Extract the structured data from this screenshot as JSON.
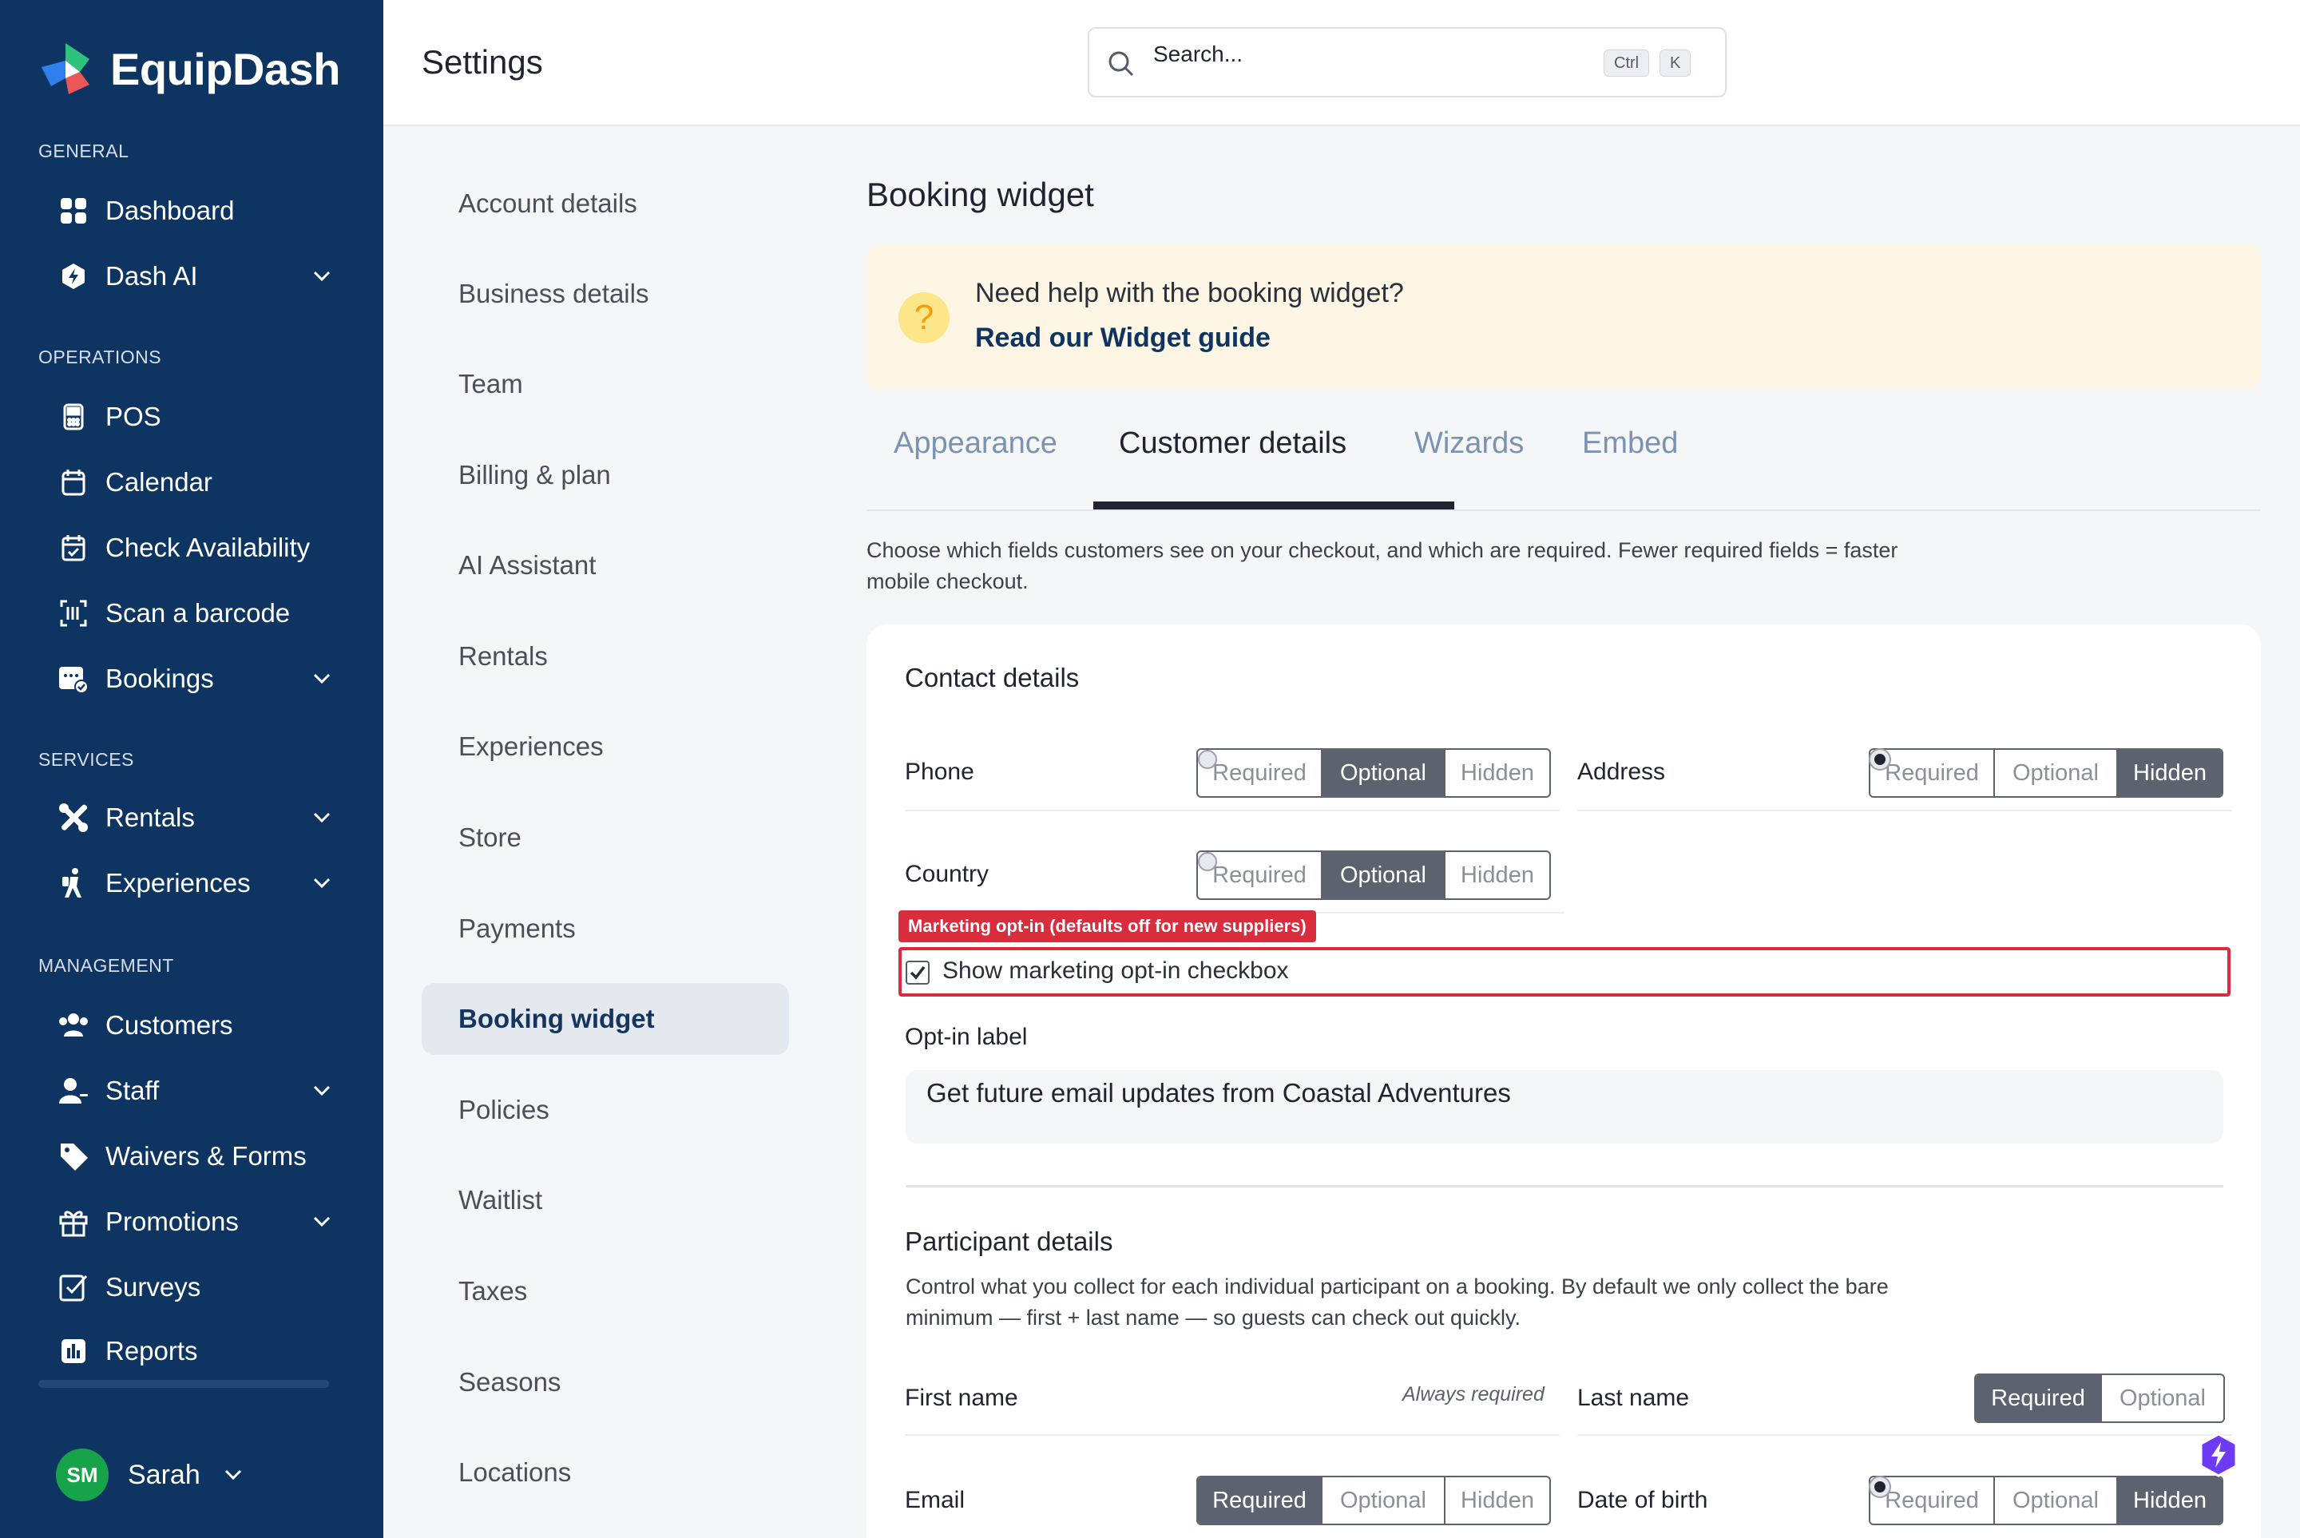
{
  "brand": {
    "name": "EquipDash"
  },
  "sidebar": {
    "sections": {
      "general": "GENERAL",
      "operations": "OPERATIONS",
      "services": "SERVICES",
      "management": "MANAGEMENT"
    },
    "items": [
      {
        "label": "Dashboard",
        "icon": "grid-icon"
      },
      {
        "label": "Dash AI",
        "icon": "sparkle-hex-icon"
      },
      {
        "label": "POS",
        "icon": "pos-terminal-icon"
      },
      {
        "label": "Calendar",
        "icon": "calendar-icon"
      },
      {
        "label": "Check Availability",
        "icon": "calendar-check-icon"
      },
      {
        "label": "Scan a barcode",
        "icon": "barcode-scan-icon"
      },
      {
        "label": "Bookings",
        "icon": "bookings-calendar-icon"
      },
      {
        "label": "Rentals",
        "icon": "tools-icon"
      },
      {
        "label": "Experiences",
        "icon": "hiking-person-icon"
      },
      {
        "label": "Customers",
        "icon": "users-icon"
      },
      {
        "label": "Staff",
        "icon": "staff-icon"
      },
      {
        "label": "Waivers & Forms",
        "icon": "tag-icon"
      },
      {
        "label": "Promotions",
        "icon": "gift-icon"
      },
      {
        "label": "Surveys",
        "icon": "checklist-icon"
      },
      {
        "label": "Reports",
        "icon": "bar-chart-icon"
      }
    ],
    "user": {
      "initials": "SM",
      "name": "Sarah"
    }
  },
  "topbar": {
    "title": "Settings",
    "search": {
      "placeholder": "Search...",
      "shortcut_1": "Ctrl",
      "shortcut_2": "K"
    }
  },
  "settings_nav": [
    "Account details",
    "Business details",
    "Team",
    "Billing & plan",
    "AI Assistant",
    "Rentals",
    "Experiences",
    "Store",
    "Payments",
    "Booking widget",
    "Policies",
    "Waitlist",
    "Taxes",
    "Seasons",
    "Locations"
  ],
  "main": {
    "heading": "Booking widget",
    "help": {
      "question": "Need help with the booking widget?",
      "link": "Read our Widget guide"
    },
    "tabs": [
      "Appearance",
      "Customer details",
      "Wizards",
      "Embed"
    ],
    "intro": "Choose which fields customers see on your checkout, and which are required. Fewer required fields = faster mobile checkout.",
    "contact": {
      "title": "Contact details",
      "fields": [
        {
          "label": "Phone",
          "selected": "Optional"
        },
        {
          "label": "Address",
          "selected": "Hidden"
        },
        {
          "label": "Country",
          "selected": "Optional"
        }
      ],
      "options": {
        "required": "Required",
        "optional": "Optional",
        "hidden": "Hidden"
      },
      "marketing_badge": "Marketing opt-in (defaults off for new suppliers)",
      "marketing_checkbox": "Show marketing opt-in checkbox",
      "marketing_checked": true,
      "optin_label": "Opt-in label",
      "optin_value": "Get future email updates from Coastal Adventures"
    },
    "participant": {
      "title": "Participant details",
      "desc": "Control what you collect for each individual participant on a booking. By default we only collect the bare minimum — first + last name — so guests can check out quickly.",
      "first_name": "First name",
      "always_required": "Always required",
      "last_name": "Last name",
      "email": "Email",
      "dob": "Date of birth"
    }
  },
  "colors": {
    "sidebar": "#0e3461",
    "accent": "#0e3461",
    "highlight": "#d92d3e",
    "segment_selected": "#5d636e"
  }
}
